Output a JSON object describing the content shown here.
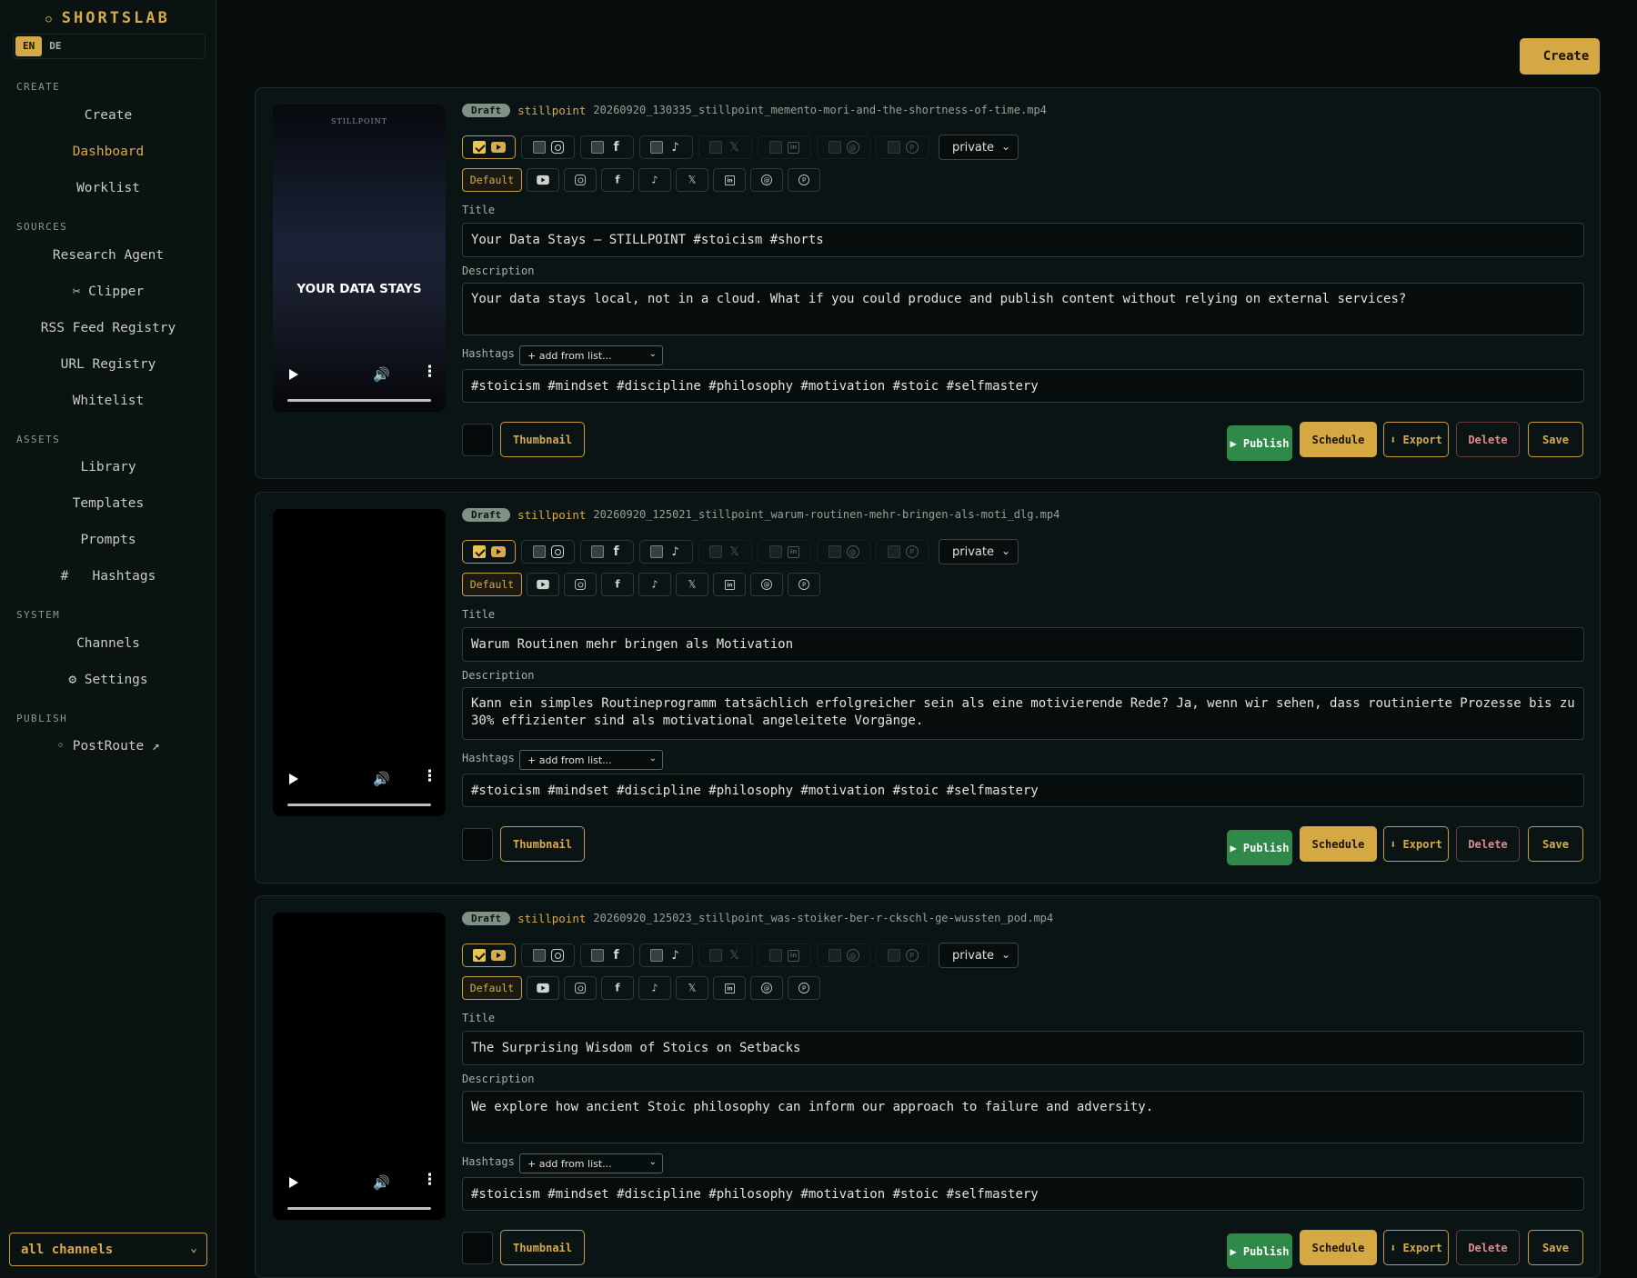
{
  "app": {
    "brand": "SHORTSLAB",
    "lang": {
      "active": "EN",
      "other": "DE"
    }
  },
  "sidebar": {
    "sections": [
      {
        "title": "CREATE",
        "items": [
          "Create",
          "Dashboard",
          "Worklist"
        ]
      },
      {
        "title": "SOURCES",
        "items": [
          "Research Agent",
          "✂ Clipper",
          "RSS Feed Registry",
          "URL Registry",
          "Whitelist"
        ]
      },
      {
        "title": "ASSETS",
        "items": [
          "Library",
          "Templates",
          "Prompts",
          "#   Hashtags"
        ]
      },
      {
        "title": "SYSTEM",
        "items": [
          "Channels",
          "⚙ Settings"
        ]
      },
      {
        "title": "PUBLISH",
        "items": [
          "◦ PostRoute ↗"
        ]
      }
    ],
    "active_item": "Dashboard",
    "channel_filter": "all channels"
  },
  "toolbar": {
    "create_label": "Create"
  },
  "labels": {
    "title": "Title",
    "description": "Description",
    "hashtags": "Hashtags",
    "add_from_list": "+ add from list...",
    "default_tab": "Default",
    "thumbnail": "Thumbnail",
    "publish": "▶ Publish",
    "schedule": "Schedule",
    "export": "⬇ Export",
    "delete": "Delete",
    "save": "Save"
  },
  "icons": {
    "youtube": "youtube-icon",
    "instagram": "instagram-icon",
    "facebook": "facebook-icon",
    "tiktok": "tiktok-icon",
    "x": "x-icon",
    "linkedin": "linkedin-icon",
    "threads": "threads-icon",
    "pinterest": "pinterest-icon"
  },
  "colors": {
    "accent": "#d4a843",
    "publish": "#2f8a4a",
    "delete": "#e08a8a",
    "background": "#080d0d"
  },
  "posts": [
    {
      "status": "Draft",
      "channel": "stillpoint",
      "filename": "20260920_130335_stillpoint_memento-mori-and-the-shortness-of-time.mp4",
      "visibility": "private",
      "poster_brand": "STILLPOINT",
      "poster_text": "YOUR DATA STAYS",
      "title": "Your Data Stays — STILLPOINT #stoicism #shorts",
      "description": "Your data stays local, not in a cloud. What if you could produce and publish content without relying on external services?",
      "hashtags": "#stoicism #mindset #discipline #philosophy #motivation #stoic #selfmastery"
    },
    {
      "status": "Draft",
      "channel": "stillpoint",
      "filename": "20260920_125021_stillpoint_warum-routinen-mehr-bringen-als-moti_dlg.mp4",
      "visibility": "private",
      "title": "Warum Routinen mehr bringen als Motivation",
      "description": "Kann ein simples Routineprogramm tatsächlich erfolgreicher sein als eine motivierende Rede? Ja, wenn wir sehen, dass routinierte Prozesse bis zu 30% effizienter sind als motivational angeleitete Vorgänge.",
      "hashtags": "#stoicism #mindset #discipline #philosophy #motivation #stoic #selfmastery"
    },
    {
      "status": "Draft",
      "channel": "stillpoint",
      "filename": "20260920_125023_stillpoint_was-stoiker-ber-r-ckschl-ge-wussten_pod.mp4",
      "visibility": "private",
      "title": "The Surprising Wisdom of Stoics on Setbacks",
      "description": "We explore how ancient Stoic philosophy can inform our approach to failure and adversity.",
      "hashtags": "#stoicism #mindset #discipline #philosophy #motivation #stoic #selfmastery"
    }
  ]
}
